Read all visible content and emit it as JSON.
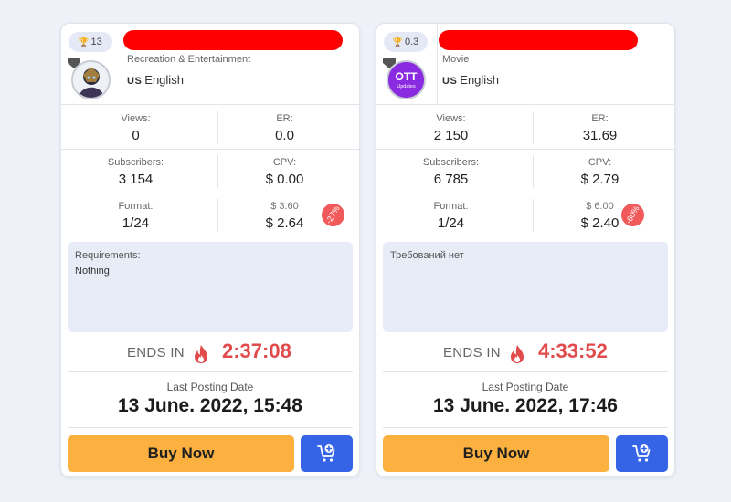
{
  "cards": [
    {
      "rating": "13",
      "category": "Recreation & Entertainment",
      "language_code": "US",
      "language": "English",
      "views_label": "Views:",
      "views": "0",
      "er_label": "ER:",
      "er": "0.0",
      "subscribers_label": "Subscribers:",
      "subscribers": "3 154",
      "cpv_label": "CPV:",
      "cpv": "$ 0.00",
      "format_label": "Format:",
      "format": "1/24",
      "old_price": "$ 3.60",
      "price": "$ 2.64",
      "discount": "-27%",
      "requirements_title": "Requirements:",
      "requirements_body": "Nothing",
      "ends_label": "ENDS IN",
      "timer": "2:37:08",
      "last_posting_label": "Last Posting Date",
      "last_posting_date": "13 June. 2022, 15:48",
      "buy_label": "Buy Now"
    },
    {
      "rating": "0.3",
      "category": "Movie",
      "language_code": "US",
      "language": "English",
      "avatar_text_1": "OTT",
      "avatar_text_2": "Updates",
      "views_label": "Views:",
      "views": "2 150",
      "er_label": "ER:",
      "er": "31.69",
      "subscribers_label": "Subscribers:",
      "subscribers": "6 785",
      "cpv_label": "CPV:",
      "cpv": "$ 2.79",
      "format_label": "Format:",
      "format": "1/24",
      "old_price": "$ 6.00",
      "price": "$ 2.40",
      "discount": "-60%",
      "requirements_title": "Требований нет",
      "requirements_body": "",
      "ends_label": "ENDS IN",
      "timer": "4:33:52",
      "last_posting_label": "Last Posting Date",
      "last_posting_date": "13 June. 2022, 17:46",
      "buy_label": "Buy Now"
    }
  ],
  "colors": {
    "buy_button": "#fbb040",
    "cart_button": "#3564e6",
    "timer": "#e24b4b",
    "discount_badge": "#f15a5a",
    "redaction": "#ff0000",
    "requirements_bg": "#e7ecf7"
  },
  "icons": [
    "trophy-icon",
    "fire-icon",
    "cart-plus-icon"
  ]
}
